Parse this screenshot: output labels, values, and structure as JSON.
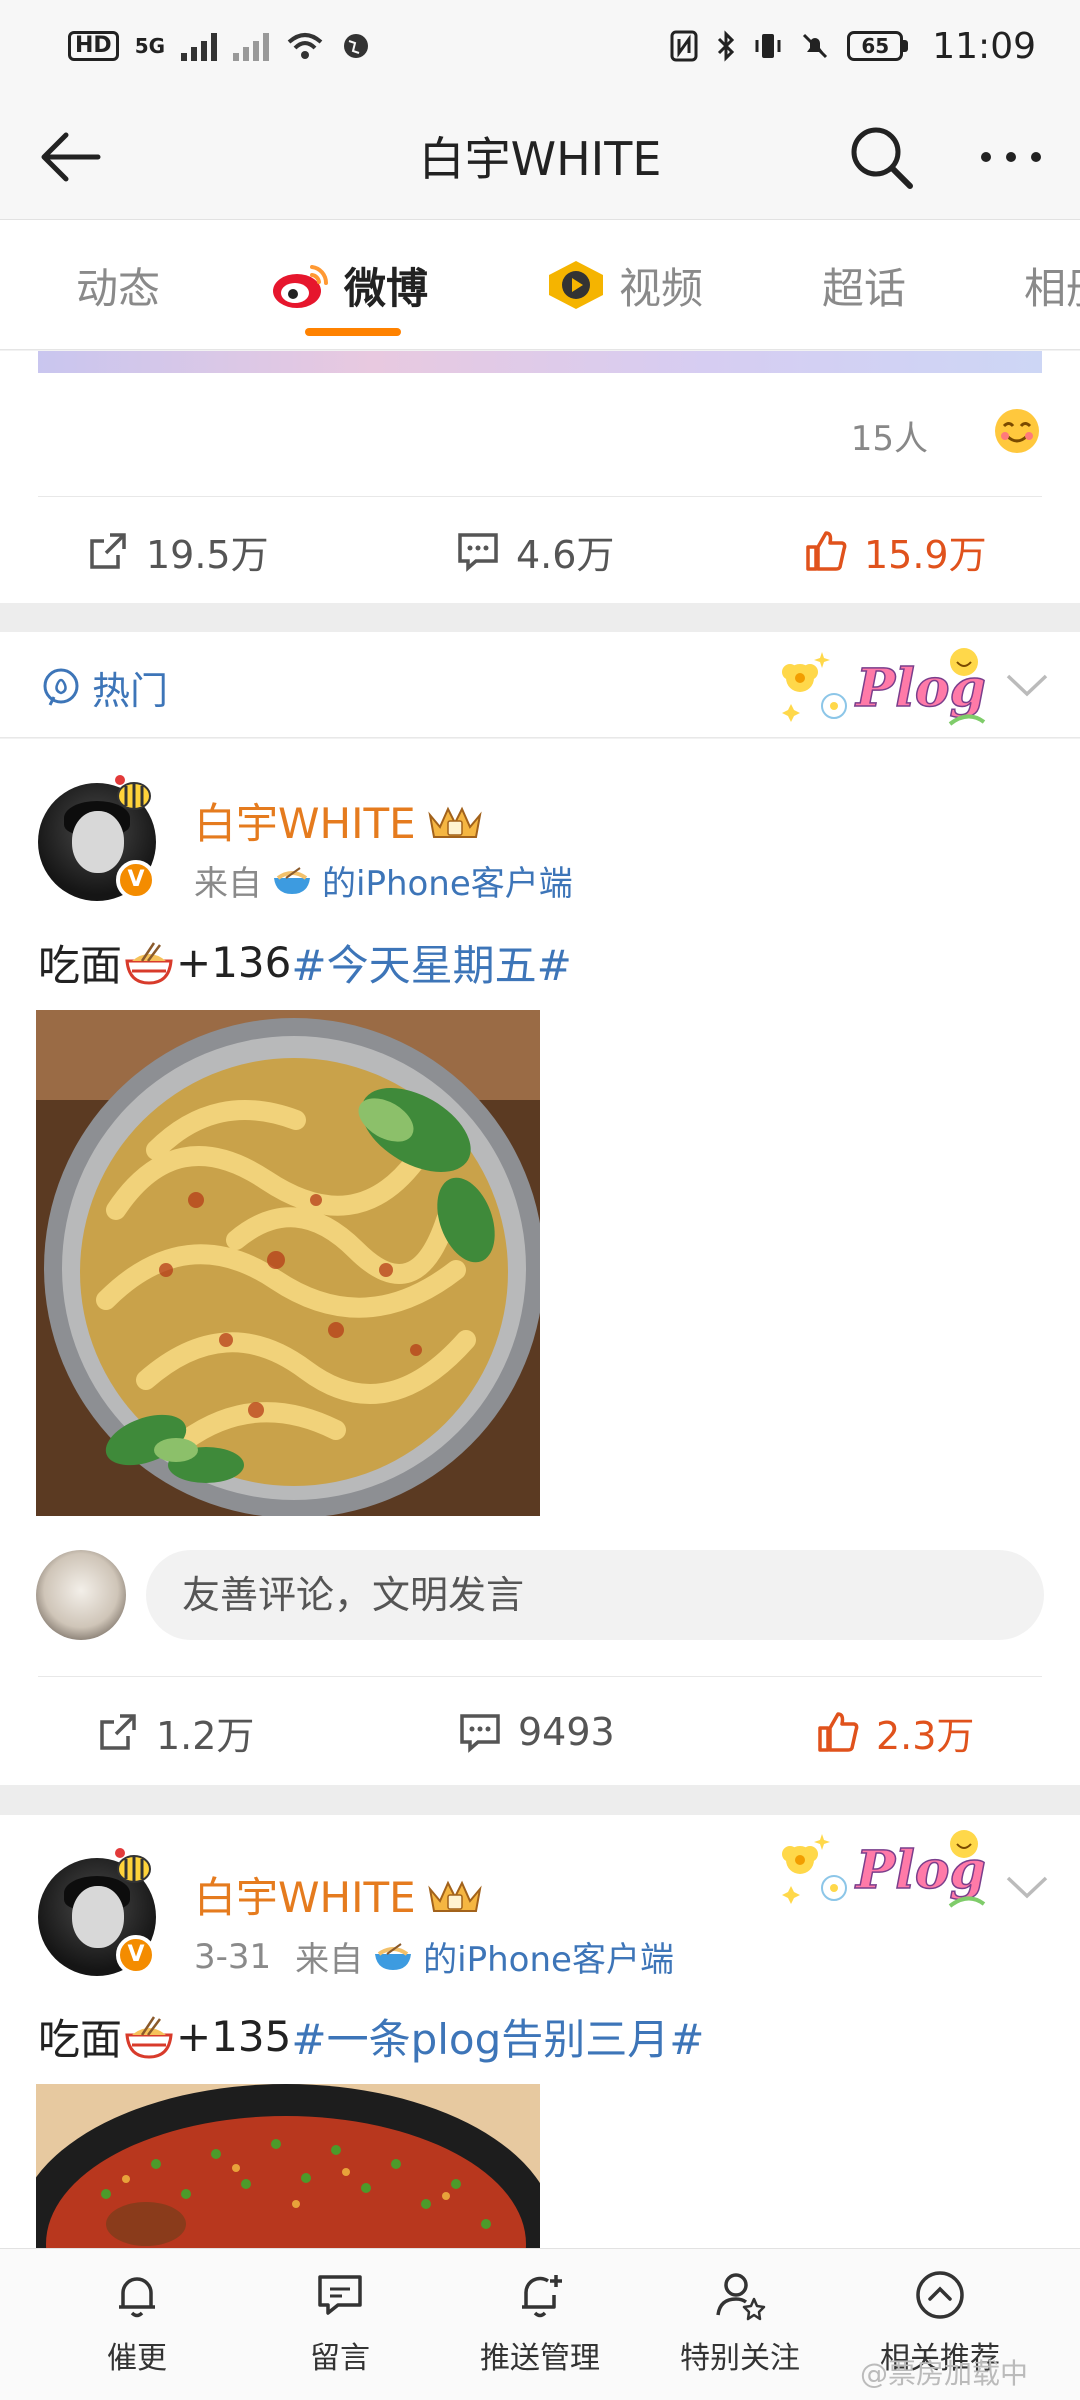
{
  "status_bar": {
    "network_badge": "HD",
    "network_type": "5G",
    "battery": "65",
    "time": "11:09"
  },
  "header": {
    "title": "白宇WHITE"
  },
  "tabs": [
    {
      "label": "动态",
      "active": false
    },
    {
      "label": "微博",
      "active": true
    },
    {
      "label": "视频",
      "active": false
    },
    {
      "label": "超话",
      "active": false
    },
    {
      "label": "相册",
      "active": false
    }
  ],
  "prev_post": {
    "reactions_count": "15人",
    "repost": "19.5万",
    "comment": "4.6万",
    "like": "15.9万"
  },
  "section": {
    "hot_label": "热门",
    "plog_sticker": "Plog"
  },
  "posts": [
    {
      "username": "白宇WHITE",
      "date": "",
      "source_prefix": "来自",
      "source_client": "的iPhone客户端",
      "text_main": "吃面",
      "text_count": "+136 ",
      "hashtag": "#今天星期五#",
      "comment_placeholder": "友善评论，文明发言",
      "repost": "1.2万",
      "comment": "9493",
      "like": "2.3万"
    },
    {
      "username": "白宇WHITE",
      "date": "3-31",
      "source_prefix": "来自",
      "source_client": "的iPhone客户端",
      "text_main": "吃面",
      "text_count": "+135",
      "hashtag": "#一条plog告别三月#"
    }
  ],
  "bottom_bar": [
    {
      "label": "催更",
      "icon": "bell-icon"
    },
    {
      "label": "留言",
      "icon": "message-icon"
    },
    {
      "label": "推送管理",
      "icon": "bell-plus-icon"
    },
    {
      "label": "特别关注",
      "icon": "user-star-icon"
    },
    {
      "label": "相关推荐",
      "icon": "arrow-up-circle-icon"
    }
  ],
  "watermark": "@票房加载中",
  "colors": {
    "accent": "#ff8200",
    "like": "#e0521c",
    "link": "#3d75b8",
    "username": "#e57b1e"
  }
}
